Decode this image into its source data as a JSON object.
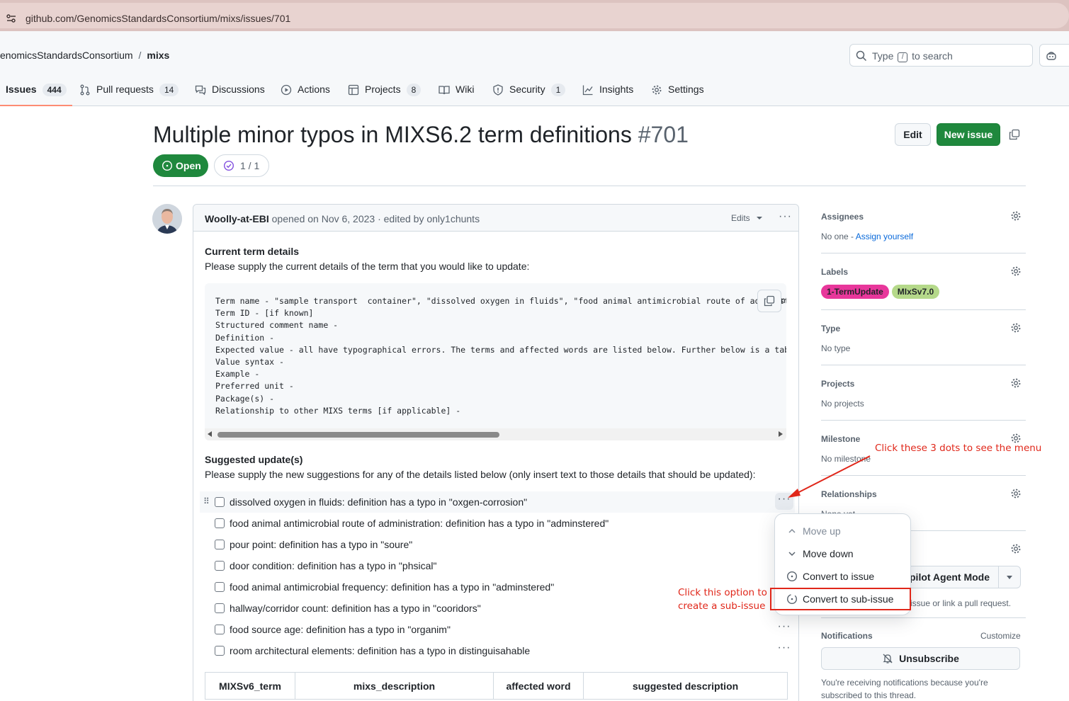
{
  "browser": {
    "url": "github.com/GenomicsStandardsConsortium/mixs/issues/701"
  },
  "header": {
    "owner": "enomicsStandardsConsortium",
    "separator": "/",
    "repo": "mixs",
    "search_before": "Type",
    "search_key": "/",
    "search_after": "to search"
  },
  "tabs": [
    {
      "label": "Issues",
      "count": "444"
    },
    {
      "label": "Pull requests",
      "count": "14"
    },
    {
      "label": "Discussions"
    },
    {
      "label": "Actions"
    },
    {
      "label": "Projects",
      "count": "8"
    },
    {
      "label": "Wiki"
    },
    {
      "label": "Security",
      "count": "1"
    },
    {
      "label": "Insights"
    },
    {
      "label": "Settings"
    }
  ],
  "issue": {
    "title": "Multiple minor typos in MIXS6.2 term definitions",
    "number": "#701",
    "edit_label": "Edit",
    "new_issue_label": "New issue",
    "state": "Open",
    "sub_issue_progress": "1 / 1"
  },
  "comment": {
    "author": "Woolly-at-EBI",
    "meta": " opened on Nov 6, 2023 · edited by only1chunts",
    "edits_label": "Edits",
    "section1_heading": "Current term details",
    "section1_text": "Please supply the current details of the term that you would like to update:",
    "code": "Term name - \"sample transport  container\", \"dissolved oxygen in fluids\", \"food animal antimicrobial route of administ\nTerm ID - [if known]\nStructured comment name -\nDefinition -\nExpected value - all have typographical errors. The terms and affected words are listed below. Further below is a table of \nValue syntax -\nExample -\nPreferred unit -\nPackage(s) -\nRelationship to other MIXS terms [if applicable] -",
    "code_overflow_char": "n",
    "section2_heading": "Suggested update(s)",
    "section2_text": "Please supply the new suggestions for any of the details listed below (only insert text to those details that should be updated):",
    "tasks": [
      "dissolved oxygen in fluids: definition has a typo in \"oxgen-corrosion\"",
      "food animal antimicrobial route of administration: definition has a typo in \"adminstered\"",
      "pour point: definition has a typo in \"soure\"",
      "door condition: definition has a typo in \"phsical\"",
      "food animal antimicrobial frequency: definition has a typo in \"adminstered\"",
      "hallway/corridor count: definition has a typo in \"cooridors\"",
      "food source age: definition has a typo in \"organim\"",
      "room architectural elements: definition has a typo in distinguisahable"
    ],
    "table_headers": [
      "MIXSv6_term",
      "mixs_description",
      "affected word",
      "suggested description"
    ]
  },
  "sidebar": {
    "assignees": {
      "heading": "Assignees",
      "value": "No one - ",
      "link": "Assign yourself"
    },
    "labels": {
      "heading": "Labels",
      "items": [
        {
          "name": "1-TermUpdate",
          "color": "#e8379b"
        },
        {
          "name": "MIxSv7.0",
          "color": "#b5d98a"
        }
      ]
    },
    "type": {
      "heading": "Type",
      "value": "No type"
    },
    "projects": {
      "heading": "Projects",
      "value": "No projects"
    },
    "milestone": {
      "heading": "Milestone",
      "value": "No milestone"
    },
    "relationships": {
      "heading": "Relationships",
      "value": "None yet"
    },
    "development": {
      "agent_button": "pilot Agent Mode",
      "note": "issue or link a pull request."
    },
    "notifications": {
      "heading": "Notifications",
      "customize": "Customize",
      "unsubscribe": "Unsubscribe",
      "note_line1": "You're receiving notifications because you're",
      "note_line2": "subscribed to this thread."
    }
  },
  "menu": {
    "items": [
      "Move up",
      "Move down",
      "Convert to issue",
      "Convert to sub-issue"
    ]
  },
  "annotations": {
    "dots_hint": "Click these 3 dots to see the menu",
    "option_hint_line1": "Click this option to",
    "option_hint_line2": "create a sub-issue"
  },
  "colors": {
    "open_green": "#1f883d",
    "annotation_red": "#e0271a",
    "tab_underline": "#fd8c73"
  }
}
